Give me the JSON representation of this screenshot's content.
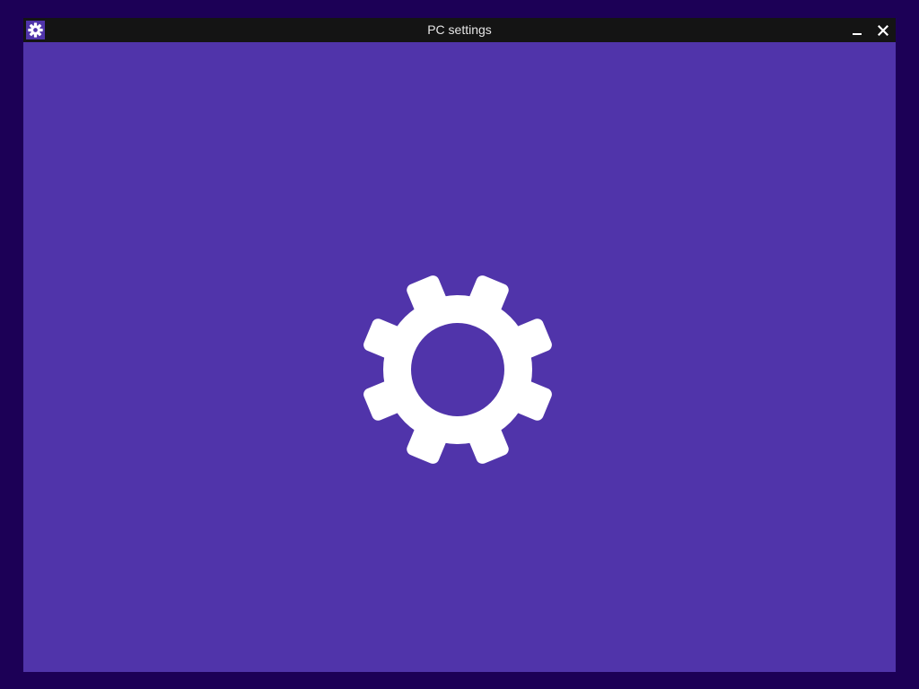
{
  "window": {
    "title": "PC settings",
    "app_icon": "gear-icon",
    "controls": {
      "minimize_icon": "minimize-icon",
      "close_icon": "close-icon"
    }
  },
  "splash": {
    "icon": "gear-icon"
  },
  "colors": {
    "desktop_background": "#1c0056",
    "accent": "#5034aa",
    "titlebar": "#141414",
    "icon_foreground": "#ffffff"
  }
}
